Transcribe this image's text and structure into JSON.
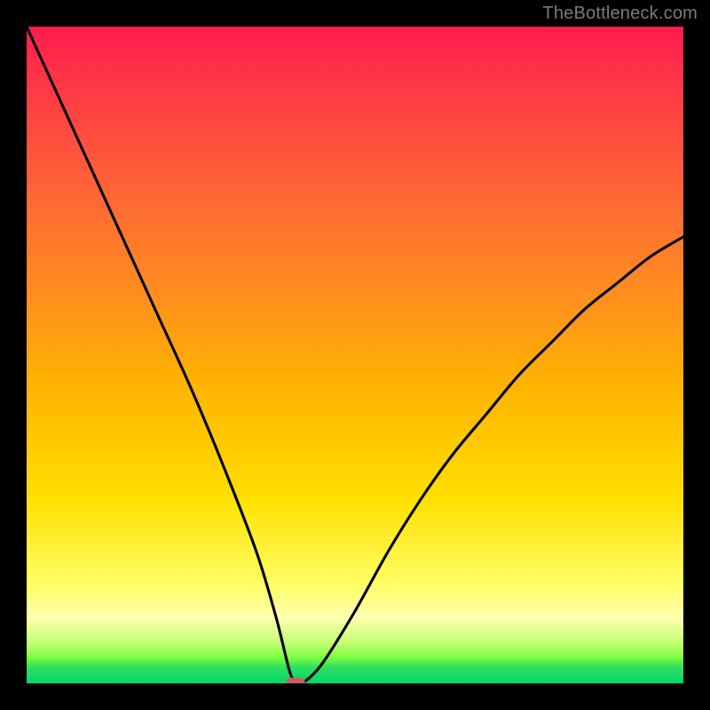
{
  "watermark": "TheBottleneck.com",
  "chart_data": {
    "type": "line",
    "title": "",
    "xlabel": "",
    "ylabel": "",
    "xlim": [
      0,
      100
    ],
    "ylim": [
      0,
      100
    ],
    "grid": false,
    "legend": false,
    "background_gradient": {
      "top": "#ff1a4d",
      "bottom": "#00d868"
    },
    "series": [
      {
        "name": "bottleneck-curve",
        "color": "#000000",
        "x": [
          0,
          5,
          10,
          15,
          20,
          25,
          30,
          35,
          38,
          40,
          41,
          42,
          45,
          50,
          55,
          60,
          65,
          70,
          75,
          80,
          85,
          90,
          95,
          100
        ],
        "y": [
          100,
          89,
          78,
          67,
          56,
          45,
          33,
          20,
          10,
          2,
          0,
          0,
          3,
          11,
          20,
          28,
          35,
          41,
          47,
          52,
          57,
          61,
          65,
          68
        ]
      }
    ],
    "marker": {
      "x": 41,
      "y": 0,
      "color": "#c56060",
      "shape": "rounded-pill"
    }
  }
}
